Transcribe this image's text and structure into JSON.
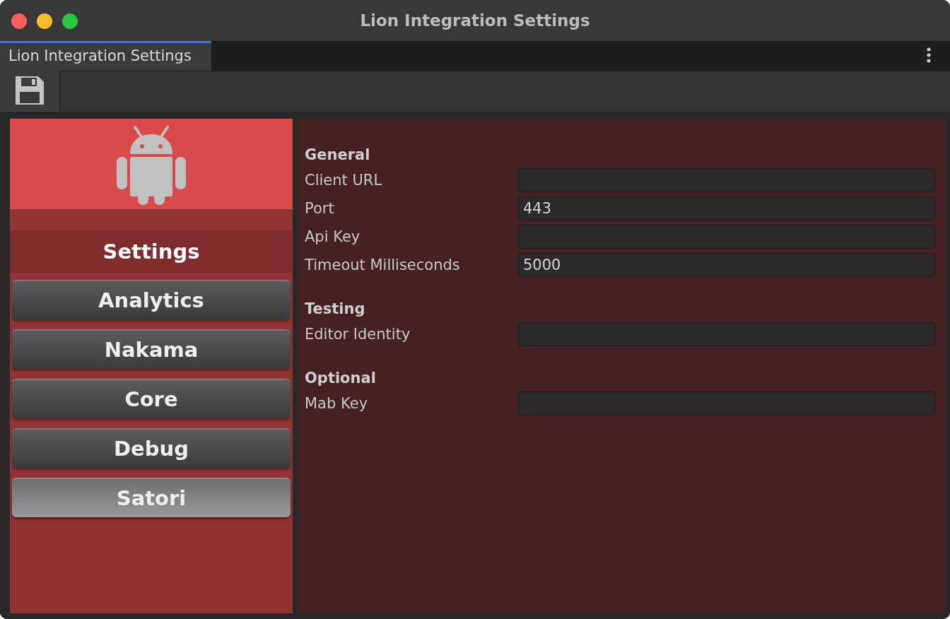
{
  "window": {
    "title": "Lion Integration Settings"
  },
  "tabs": [
    {
      "label": "Lion Integration Settings",
      "selected": true
    }
  ],
  "sidebar": {
    "header": "Settings",
    "items": [
      {
        "label": "Analytics",
        "selected": false
      },
      {
        "label": "Nakama",
        "selected": false
      },
      {
        "label": "Core",
        "selected": false
      },
      {
        "label": "Debug",
        "selected": false
      },
      {
        "label": "Satori",
        "selected": true
      }
    ]
  },
  "sections": [
    {
      "title": "General",
      "fields": [
        {
          "label": "Client URL"
        },
        {
          "label": "Port",
          "value": "443"
        },
        {
          "label": "Api Key"
        },
        {
          "label": "Timeout Milliseconds",
          "value": "5000"
        }
      ]
    },
    {
      "title": "Testing",
      "fields": [
        {
          "label": "Editor Identity"
        }
      ]
    },
    {
      "title": "Optional",
      "fields": [
        {
          "label": "Mab Key"
        }
      ]
    }
  ]
}
